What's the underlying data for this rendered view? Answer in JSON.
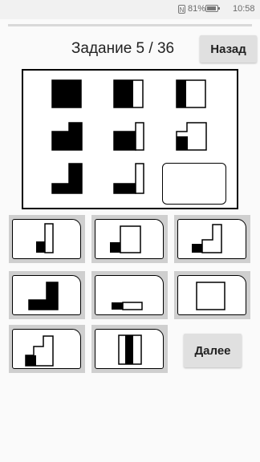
{
  "status_bar": {
    "nfc_label": "N",
    "battery_percent": "81%",
    "time": "10:58"
  },
  "header": {
    "title": "Задание 5 / 36",
    "back_label": "Назад"
  },
  "footer": {
    "next_label": "Далее"
  },
  "matrix": {
    "cells": [
      {
        "id": "r1c1",
        "shape": "black-square"
      },
      {
        "id": "r1c2",
        "shape": "square-left-black-right-white"
      },
      {
        "id": "r1c3",
        "shape": "square-narrow-black-left"
      },
      {
        "id": "r2c1",
        "shape": "black-step-notch"
      },
      {
        "id": "r2c2",
        "shape": "black-step-small-white-tab"
      },
      {
        "id": "r2c3",
        "shape": "black-bottom-white-step"
      },
      {
        "id": "r3c1",
        "shape": "black-l-shape"
      },
      {
        "id": "r3c2",
        "shape": "black-bottom-white-tab"
      },
      {
        "id": "r3c3",
        "shape": "empty-answer-slot"
      }
    ]
  },
  "options": [
    {
      "id": "option-1",
      "shape": "small-black-tall-white"
    },
    {
      "id": "option-2",
      "shape": "small-black-white-square"
    },
    {
      "id": "option-3",
      "shape": "small-black-white-l"
    },
    {
      "id": "option-4",
      "shape": "black-l-shape"
    },
    {
      "id": "option-5",
      "shape": "black-white-bar"
    },
    {
      "id": "option-6",
      "shape": "white-square"
    },
    {
      "id": "option-7",
      "shape": "black-white-stairs"
    },
    {
      "id": "option-8",
      "shape": "white-black-white-column"
    }
  ]
}
